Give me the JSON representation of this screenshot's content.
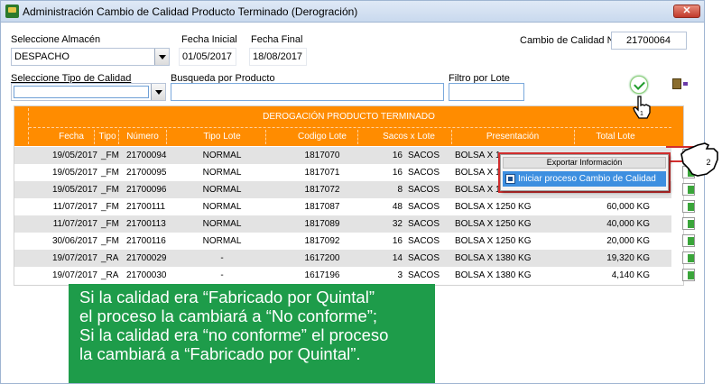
{
  "window": {
    "title": "Administración Cambio de Calidad Producto Terminado (Derogración)",
    "close_label": "✕"
  },
  "filters": {
    "almacen_label": "Seleccione Almacén",
    "almacen_value": "DESPACHO",
    "fecha_inicial_label": "Fecha Inicial",
    "fecha_inicial_value": "01/05/2017",
    "fecha_final_label": "Fecha Final",
    "fecha_final_value": "18/08/2017",
    "cambio_label": "Cambio de Calidad No.",
    "cambio_value": "21700064",
    "tipo_calidad_label": "Seleccione Tipo de Calidad",
    "tipo_calidad_value": "",
    "busqueda_label": "Busqueda por Producto",
    "busqueda_value": "",
    "filtro_lote_label": "Filtro por Lote",
    "filtro_lote_value": ""
  },
  "grid": {
    "band_title": "DEROGACIÓN PRODUCTO TERMINADO",
    "columns": [
      "Fecha",
      "Tipo",
      "Número",
      "Tipo Lote",
      "Codigo Lote",
      "Sacos x Lote",
      "Presentación",
      "Total Lote"
    ],
    "rows": [
      {
        "fecha": "19/05/2017",
        "tipo": "_FM",
        "numero": "21700094",
        "tipo_lote": "NORMAL",
        "codigo": "1817070",
        "sacos": "16",
        "unidad": "SACOS",
        "presentacion": "BOLSA X 1",
        "total": ""
      },
      {
        "fecha": "19/05/2017",
        "tipo": "_FM",
        "numero": "21700095",
        "tipo_lote": "NORMAL",
        "codigo": "1817071",
        "sacos": "16",
        "unidad": "SACOS",
        "presentacion": "BOLSA X 1",
        "total": ""
      },
      {
        "fecha": "19/05/2017",
        "tipo": "_FM",
        "numero": "21700096",
        "tipo_lote": "NORMAL",
        "codigo": "1817072",
        "sacos": "8",
        "unidad": "SACOS",
        "presentacion": "BOLSA X 1",
        "total": ""
      },
      {
        "fecha": "11/07/2017",
        "tipo": "_FM",
        "numero": "21700111",
        "tipo_lote": "NORMAL",
        "codigo": "1817087",
        "sacos": "48",
        "unidad": "SACOS",
        "presentacion": "BOLSA X 1250 KG",
        "total": "60,000 KG"
      },
      {
        "fecha": "11/07/2017",
        "tipo": "_FM",
        "numero": "21700113",
        "tipo_lote": "NORMAL",
        "codigo": "1817089",
        "sacos": "32",
        "unidad": "SACOS",
        "presentacion": "BOLSA X 1250 KG",
        "total": "40,000 KG"
      },
      {
        "fecha": "30/06/2017",
        "tipo": "_FM",
        "numero": "21700116",
        "tipo_lote": "NORMAL",
        "codigo": "1817092",
        "sacos": "16",
        "unidad": "SACOS",
        "presentacion": "BOLSA X 1250 KG",
        "total": "20,000 KG"
      },
      {
        "fecha": "19/07/2017",
        "tipo": "_RA",
        "numero": "21700029",
        "tipo_lote": "-",
        "codigo": "1617200",
        "sacos": "14",
        "unidad": "SACOS",
        "presentacion": "BOLSA X 1380 KG",
        "total": "19,320 KG"
      },
      {
        "fecha": "19/07/2017",
        "tipo": "_RA",
        "numero": "21700030",
        "tipo_lote": "-",
        "codigo": "1617196",
        "sacos": "3",
        "unidad": "SACOS",
        "presentacion": "BOLSA X 1380 KG",
        "total": "4,140 KG"
      }
    ]
  },
  "context_menu": {
    "header": "Exportar Información",
    "item": "Iniciar proceso Cambio de Calidad"
  },
  "annotations": {
    "step_1": "1",
    "step_2": "2",
    "callout_lines": [
      "Si la calidad era “Fabricado por Quintal”",
      "el proceso la cambiará a “No conforme”;",
      "Si la calidad era “no conforme” el proceso",
      "la cambiará a “Fabricado por Quintal”."
    ]
  },
  "colors": {
    "accent_orange": "#ff8c00",
    "callout_green": "#1e9c4a",
    "menu_highlight": "#3d8fe0",
    "annotation_red": "#d32f2f"
  }
}
